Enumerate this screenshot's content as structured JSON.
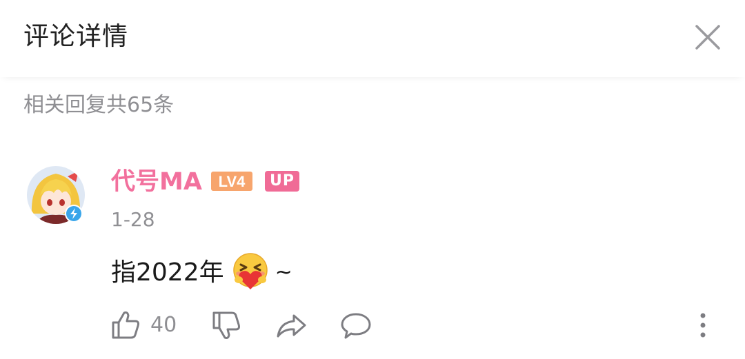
{
  "header": {
    "title": "评论详情",
    "close_icon": "close-icon"
  },
  "replies": {
    "count_text": "相关回复共65条"
  },
  "comment": {
    "username": "代号MA",
    "username_color": "#f2709d",
    "level_badge": "LV4",
    "up_badge": "UP",
    "date": "1-28",
    "text": "指2022年",
    "emote": "heart-hug-emoji",
    "trailing_text": "~",
    "like_count": "40"
  },
  "colors": {
    "accent_pink": "#f06b96",
    "level_orange": "#f7a56d",
    "secondary_text": "#8f8f93",
    "verified_blue": "#3aa6ea"
  }
}
